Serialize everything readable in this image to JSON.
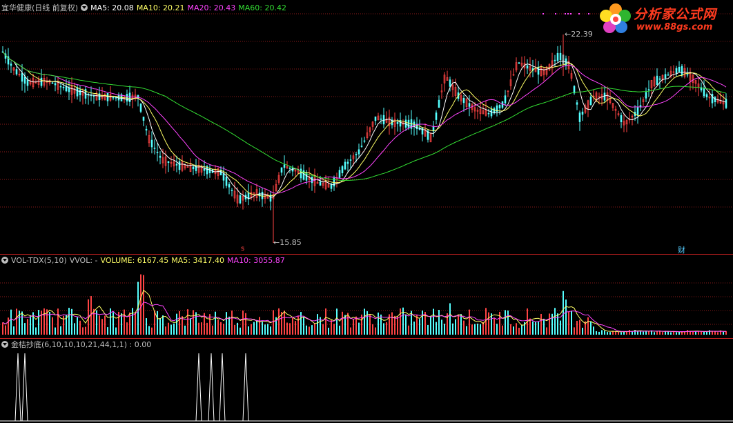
{
  "main_panel": {
    "title": "宜华健康(日线 前复权)",
    "ma_labels": [
      {
        "text": "MA5: 20.08",
        "color": "#ffffff"
      },
      {
        "text": "MA10: 20.21",
        "color": "#ffff66"
      },
      {
        "text": "MA20: 20.43",
        "color": "#ff44ff"
      },
      {
        "text": "MA60: 20.42",
        "color": "#33dd33"
      }
    ],
    "high_label": "22.39",
    "low_label": "15.85",
    "marker_s": "s",
    "marker_cai": "财"
  },
  "volume_panel": {
    "title": "VOL-TDX(5,10)",
    "vvol": "VVOL: -",
    "labels": [
      {
        "text": "VOLUME: 6167.45",
        "color": "#ffff66"
      },
      {
        "text": "MA5: 3417.40",
        "color": "#ffff66"
      },
      {
        "text": "MA10: 3055.87",
        "color": "#ff44ff"
      }
    ]
  },
  "indicator_panel": {
    "title": "金桔抄底(6,10,10,10,21,44,1,1) : 0.00"
  },
  "logo": {
    "title": "分析家公式网",
    "url": "www.88gs.com"
  },
  "colors": {
    "up": "#ff4444",
    "down": "#55ffff",
    "ma5": "#ffffff",
    "ma10": "#ffff66",
    "ma20": "#ff44ff",
    "ma60": "#33dd33",
    "grid": "#8a1a1a",
    "separator": "#c02020"
  }
}
